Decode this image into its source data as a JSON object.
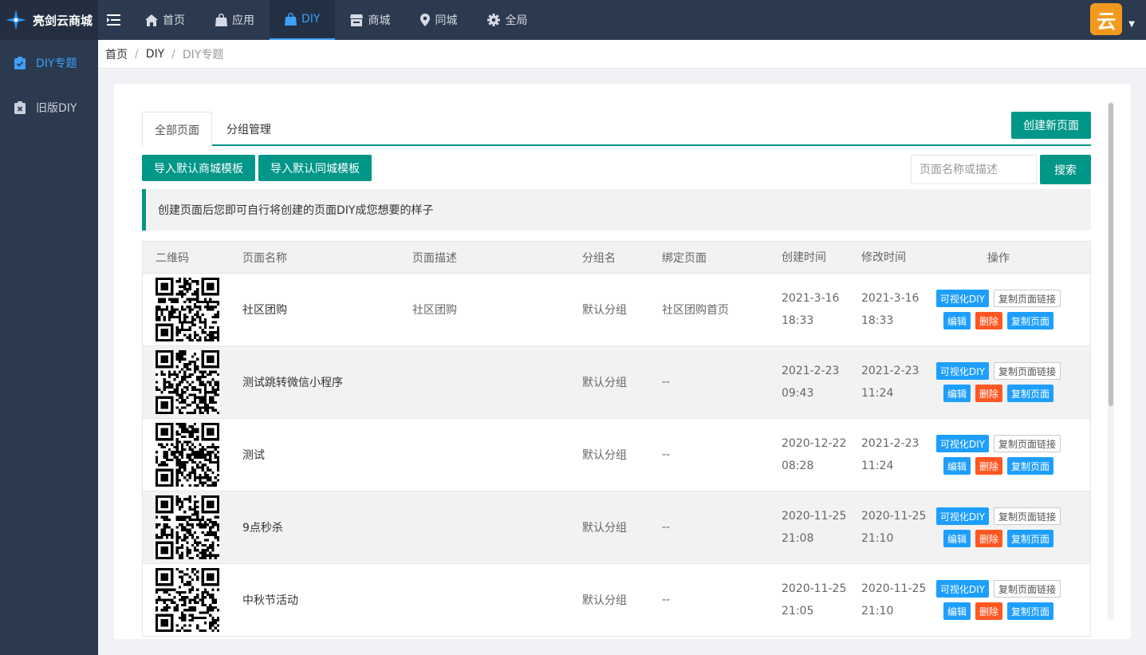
{
  "app": {
    "name": "亮剑云商城"
  },
  "nav": {
    "items": [
      {
        "label": "首页",
        "icon": "home-icon"
      },
      {
        "label": "应用",
        "icon": "bag-icon"
      },
      {
        "label": "DIY",
        "icon": "bag-icon",
        "active": true
      },
      {
        "label": "商城",
        "icon": "store-icon"
      },
      {
        "label": "同城",
        "icon": "location-icon"
      },
      {
        "label": "全局",
        "icon": "gear-icon"
      }
    ]
  },
  "user": {
    "avatar_text": "云"
  },
  "sidebar": {
    "items": [
      {
        "label": "DIY专题",
        "icon": "checklist-icon",
        "active": true
      },
      {
        "label": "旧版DIY",
        "icon": "clipboard-x-icon"
      }
    ]
  },
  "breadcrumb": {
    "home": "首页",
    "section": "DIY",
    "current": "DIY专题"
  },
  "tabs": {
    "all_pages": "全部页面",
    "group_manage": "分组管理"
  },
  "toolbar": {
    "create_page": "创建新页面",
    "import_mall": "导入默认商城模板",
    "import_city": "导入默认同城模板",
    "search_placeholder": "页面名称或描述",
    "search": "搜索"
  },
  "tip": "创建页面后您即可自行将创建的页面DIY成您想要的样子",
  "table": {
    "headers": {
      "qr": "二维码",
      "name": "页面名称",
      "desc": "页面描述",
      "group": "分组名",
      "bind": "绑定页面",
      "created": "创建时间",
      "modified": "修改时间",
      "ops": "操作"
    },
    "op_labels": {
      "visual": "可视化DIY",
      "copy_link": "复制页面链接",
      "edit": "编辑",
      "delete": "删除",
      "copy_page": "复制页面"
    },
    "rows": [
      {
        "name": "社区团购",
        "desc": "社区团购",
        "group": "默认分组",
        "bind": "社区团购首页",
        "created": "2021-3-16 18:33",
        "modified": "2021-3-16 18:33"
      },
      {
        "name": "测试跳转微信小程序",
        "desc": "",
        "group": "默认分组",
        "bind": "--",
        "created": "2021-2-23 09:43",
        "modified": "2021-2-23 11:24"
      },
      {
        "name": "测试",
        "desc": "",
        "group": "默认分组",
        "bind": "--",
        "created": "2020-12-22 08:28",
        "modified": "2021-2-23 11:24"
      },
      {
        "name": "9点秒杀",
        "desc": "",
        "group": "默认分组",
        "bind": "--",
        "created": "2020-11-25 21:08",
        "modified": "2020-11-25 21:10"
      },
      {
        "name": "中秋节活动",
        "desc": "",
        "group": "默认分组",
        "bind": "--",
        "created": "2020-11-25 21:05",
        "modified": "2020-11-25 21:10"
      }
    ]
  },
  "colors": {
    "primary": "#009688",
    "accent": "#3d9ff8",
    "topbar": "#2b3a4f",
    "danger": "#ff5722",
    "info": "#1e9fff"
  }
}
